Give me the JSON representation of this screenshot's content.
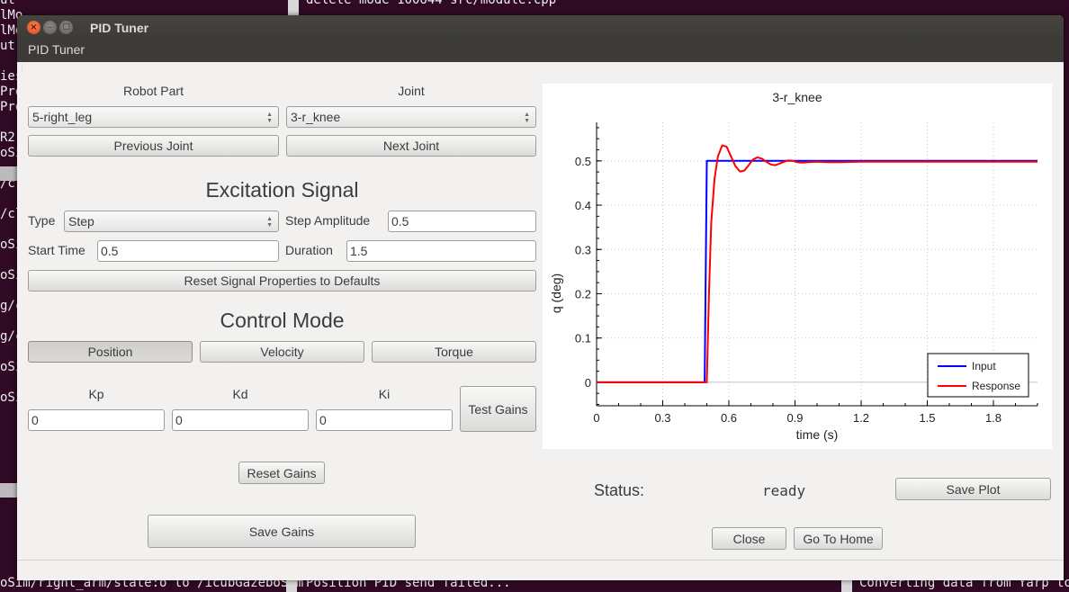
{
  "background_terminal": {
    "left_lines": [
      "ut\"",
      "lMo",
      "lMo",
      "ut\"",
      "",
      "ies",
      "Pro",
      "Pro",
      "",
      "R2",
      "oSi",
      "",
      "/cl",
      "",
      "/cl",
      "",
      "oSi",
      "",
      "oSi",
      "",
      "g/c",
      "",
      "g/c",
      "",
      "oSi",
      "",
      "oSi"
    ],
    "top_line": "delete mode 100644 src/module.cpp",
    "bottom_left": "oSim/right_arm/state:o to /icubGazeboSim",
    "bottom_mid": "Position PID send failed...",
    "bottom_right": "Converting data from Yarp to"
  },
  "window": {
    "title": "PID Tuner",
    "menu_title": "PID Tuner",
    "buttons": {
      "close": "×",
      "minimize": "–",
      "maximize": "□"
    }
  },
  "selection": {
    "robot_part_label": "Robot Part",
    "robot_part_value": "5-right_leg",
    "joint_label": "Joint",
    "joint_value": "3-r_knee",
    "previous_joint": "Previous Joint",
    "next_joint": "Next Joint"
  },
  "excitation": {
    "heading": "Excitation Signal",
    "type_label": "Type",
    "type_value": "Step",
    "step_amplitude_label": "Step Amplitude",
    "step_amplitude_value": "0.5",
    "start_time_label": "Start Time",
    "start_time_value": "0.5",
    "duration_label": "Duration",
    "duration_value": "1.5",
    "reset_button": "Reset Signal Properties to Defaults"
  },
  "control_mode": {
    "heading": "Control Mode",
    "modes": [
      {
        "label": "Position",
        "active": true
      },
      {
        "label": "Velocity",
        "active": false
      },
      {
        "label": "Torque",
        "active": false
      }
    ]
  },
  "gains": {
    "kp_label": "Kp",
    "kp_value": "0",
    "kd_label": "Kd",
    "kd_value": "0",
    "ki_label": "Ki",
    "ki_value": "0",
    "test_button": "Test Gains",
    "reset_button": "Reset Gains",
    "save_button": "Save Gains"
  },
  "status": {
    "label": "Status:",
    "value": "ready",
    "save_plot": "Save Plot",
    "close": "Close",
    "go_home": "Go To Home"
  },
  "chart_data": {
    "type": "line",
    "title": "3-r_knee",
    "xlabel": "time (s)",
    "ylabel": "q (deg)",
    "xlim": [
      0,
      2.0
    ],
    "ylim": [
      -0.053,
      0.587
    ],
    "xticks": [
      0,
      0.3,
      0.6,
      0.9,
      1.2,
      1.5,
      1.8
    ],
    "xtick_labels": [
      "0",
      "0.3",
      "0.6",
      "0.9",
      "1.2",
      "1.5",
      "1.8"
    ],
    "yticks": [
      0,
      0.1,
      0.2,
      0.3,
      0.4,
      0.5
    ],
    "ytick_labels": [
      "0",
      "0.1",
      "0.2",
      "0.3",
      "0.4",
      "0.5"
    ],
    "grid": true,
    "legend_position": "bottom-right",
    "colors": {
      "Input": "#0000ff",
      "Response": "#ff0000"
    },
    "series": [
      {
        "name": "Input",
        "x": [
          0,
          0.49,
          0.5,
          2.0
        ],
        "y": [
          0,
          0,
          0.5,
          0.5
        ]
      },
      {
        "name": "Response",
        "x": [
          0,
          0.5,
          0.51,
          0.52,
          0.535,
          0.55,
          0.57,
          0.59,
          0.61,
          0.63,
          0.65,
          0.67,
          0.69,
          0.71,
          0.73,
          0.75,
          0.77,
          0.79,
          0.81,
          0.83,
          0.85,
          0.87,
          0.89,
          0.91,
          0.93,
          0.96,
          1.0,
          1.05,
          1.1,
          1.2,
          1.4,
          1.6,
          2.0
        ],
        "y": [
          0,
          0,
          0.2,
          0.36,
          0.46,
          0.51,
          0.535,
          0.532,
          0.51,
          0.488,
          0.476,
          0.478,
          0.49,
          0.503,
          0.508,
          0.505,
          0.498,
          0.492,
          0.49,
          0.494,
          0.498,
          0.501,
          0.5,
          0.497,
          0.496,
          0.497,
          0.498,
          0.497,
          0.497,
          0.498,
          0.498,
          0.498,
          0.498
        ]
      }
    ]
  }
}
